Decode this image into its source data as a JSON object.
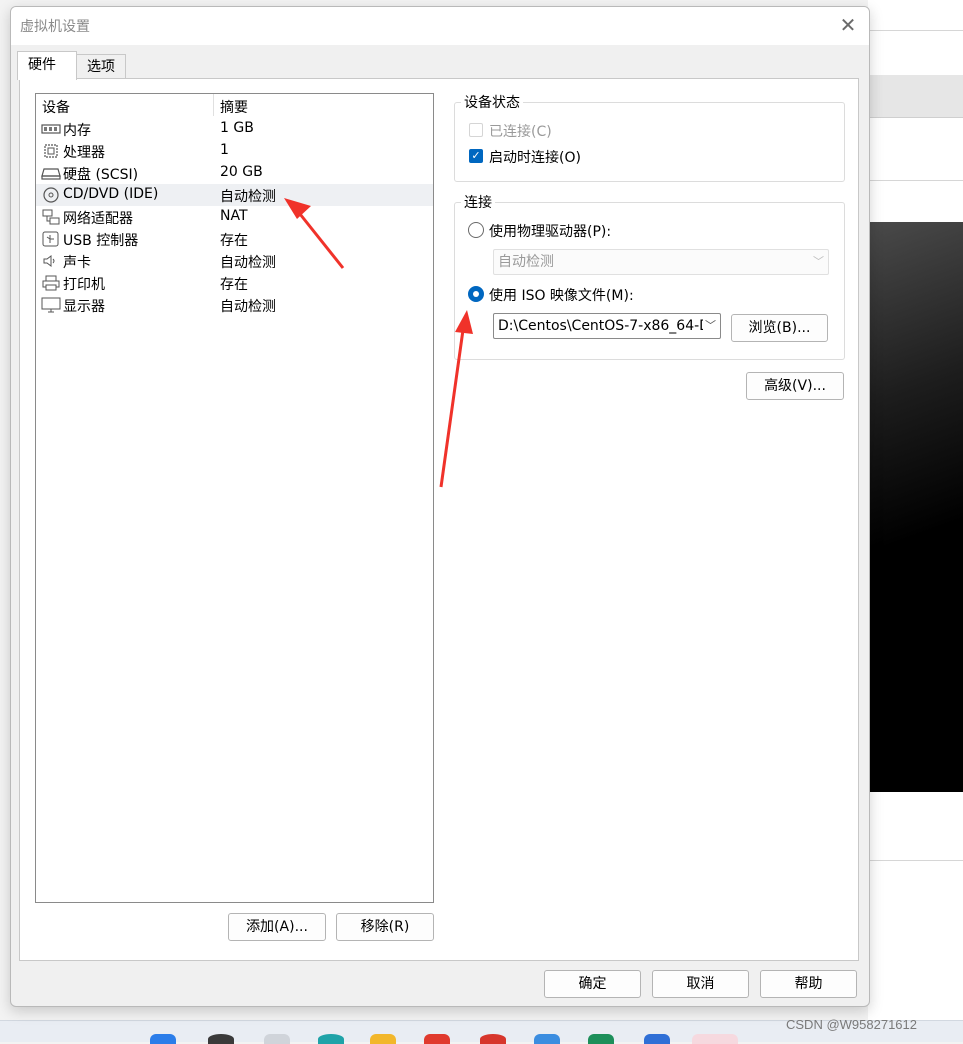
{
  "window": {
    "title": "虚拟机设置",
    "close_glyph": "✕"
  },
  "tabs": [
    {
      "label": "硬件",
      "active": true
    },
    {
      "label": "选项",
      "active": false
    }
  ],
  "device_list": {
    "columns": [
      "设备",
      "摘要"
    ],
    "rows": [
      {
        "name": "内存",
        "summary": "1 GB",
        "icon": "memory-icon"
      },
      {
        "name": "处理器",
        "summary": "1",
        "icon": "processor-icon"
      },
      {
        "name": "硬盘 (SCSI)",
        "summary": "20 GB",
        "icon": "hard-disk-icon"
      },
      {
        "name": "CD/DVD (IDE)",
        "summary": "自动检测",
        "icon": "cd-dvd-icon",
        "selected": true
      },
      {
        "name": "网络适配器",
        "summary": "NAT",
        "icon": "network-adapter-icon"
      },
      {
        "name": "USB 控制器",
        "summary": "存在",
        "icon": "usb-icon"
      },
      {
        "name": "声卡",
        "summary": "自动检测",
        "icon": "sound-card-icon"
      },
      {
        "name": "打印机",
        "summary": "存在",
        "icon": "printer-icon"
      },
      {
        "name": "显示器",
        "summary": "自动检测",
        "icon": "display-icon"
      }
    ]
  },
  "list_buttons": {
    "add": "添加(A)...",
    "remove": "移除(R)"
  },
  "device_status": {
    "group_label": "设备状态",
    "connected": {
      "label": "已连接(C)",
      "checked": false,
      "disabled": true
    },
    "connect_at_power_on": {
      "label": "启动时连接(O)",
      "checked": true
    }
  },
  "connection": {
    "group_label": "连接",
    "physical_drive": {
      "label": "使用物理驱动器(P):",
      "selected": false,
      "combo_value": "自动检测"
    },
    "iso_image": {
      "label": "使用 ISO 映像文件(M):",
      "selected": true,
      "combo_value": "D:\\Centos\\CentOS-7-x86_64-D"
    },
    "browse_label": "浏览(B)..."
  },
  "advanced_label": "高级(V)...",
  "footer_buttons": {
    "ok": "确定",
    "cancel": "取消",
    "help": "帮助"
  },
  "watermark": "CSDN @W958271612",
  "colors": {
    "accent": "#0067c0",
    "annotation_arrow": "#f0322a"
  }
}
